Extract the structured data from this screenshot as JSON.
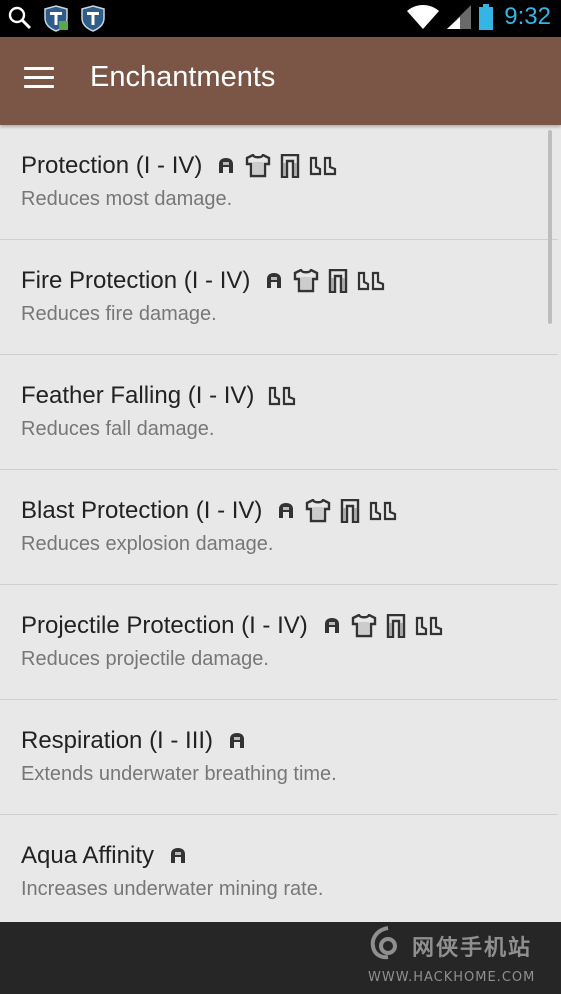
{
  "status_bar": {
    "time": "9:32",
    "left_icons": [
      "search-icon",
      "shield-icon",
      "shield-icon"
    ],
    "right_icons": [
      "wifi-icon",
      "signal-icon",
      "battery-icon"
    ],
    "time_color": "#34b5e5"
  },
  "app_bar": {
    "title": "Enchantments",
    "color": "#7b5546",
    "menu_icon": "hamburger-menu-icon"
  },
  "items": [
    {
      "title": "Protection (I - IV)",
      "desc": "Reduces most damage.",
      "icons": [
        "helmet",
        "chestplate",
        "leggings",
        "boots"
      ]
    },
    {
      "title": "Fire Protection (I - IV)",
      "desc": "Reduces fire damage.",
      "icons": [
        "helmet",
        "chestplate",
        "leggings",
        "boots"
      ]
    },
    {
      "title": "Feather Falling (I - IV)",
      "desc": "Reduces fall damage.",
      "icons": [
        "boots"
      ]
    },
    {
      "title": "Blast Protection (I - IV)",
      "desc": "Reduces explosion damage.",
      "icons": [
        "helmet",
        "chestplate",
        "leggings",
        "boots"
      ]
    },
    {
      "title": "Projectile Protection (I - IV)",
      "desc": "Reduces projectile damage.",
      "icons": [
        "helmet",
        "chestplate",
        "leggings",
        "boots"
      ]
    },
    {
      "title": "Respiration (I - III)",
      "desc": "Extends underwater breathing time.",
      "icons": [
        "helmet"
      ]
    },
    {
      "title": "Aqua Affinity",
      "desc": "Increases underwater mining rate.",
      "icons": [
        "helmet"
      ]
    }
  ],
  "watermark": {
    "cn": "网侠手机站",
    "url": "WWW.HACKHOME.COM"
  }
}
